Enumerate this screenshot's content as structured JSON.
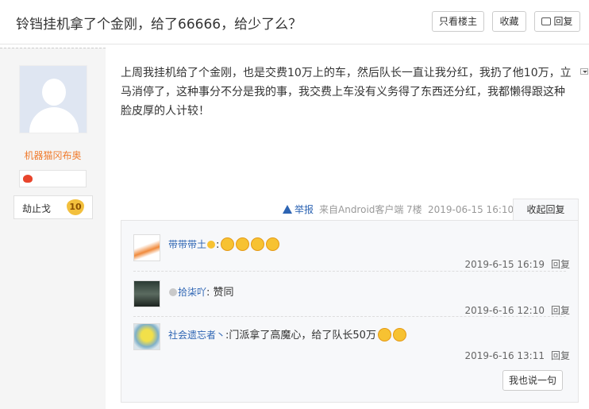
{
  "thread": {
    "title": "铃铛挂机拿了个金刚，给了66666，给少了么？"
  },
  "header": {
    "only_op": "只看楼主",
    "favorite": "收藏",
    "reply": "回复"
  },
  "author": {
    "name": "机器猫冈布奥",
    "level_name": "劫止戈",
    "level": "10"
  },
  "post": {
    "content": "上周我挂机给了个金刚，也是交费10万上的车，然后队长一直让我分红，我扔了他10万，立马消停了，这种事分不分是我的事，我交费上车没有义务得了东西还分红，我都懒得跟这种脸皮厚的人计较！",
    "report": "举报",
    "client": "来自Android客户端",
    "floor": "7楼",
    "time": "2019-06-15 16:10",
    "toggle": "收起回复"
  },
  "comments": [
    {
      "user": "带带带土",
      "text": ":",
      "time": "2019-6-15 16:19",
      "reply": "回复"
    },
    {
      "user": "拾柒吖",
      "text": ": 赞同",
      "time": "2019-6-16 12:10",
      "reply": "回复"
    },
    {
      "user": "社会遗忘者丶",
      "text": ":门派拿了高魔心，给了队长50万",
      "time": "2019-6-16 13:11",
      "reply": "回复"
    }
  ],
  "say_button": "我也说一句",
  "colors": {
    "link": "#2d64b3",
    "username": "#f07b2d",
    "badge": "#f3c03d"
  }
}
